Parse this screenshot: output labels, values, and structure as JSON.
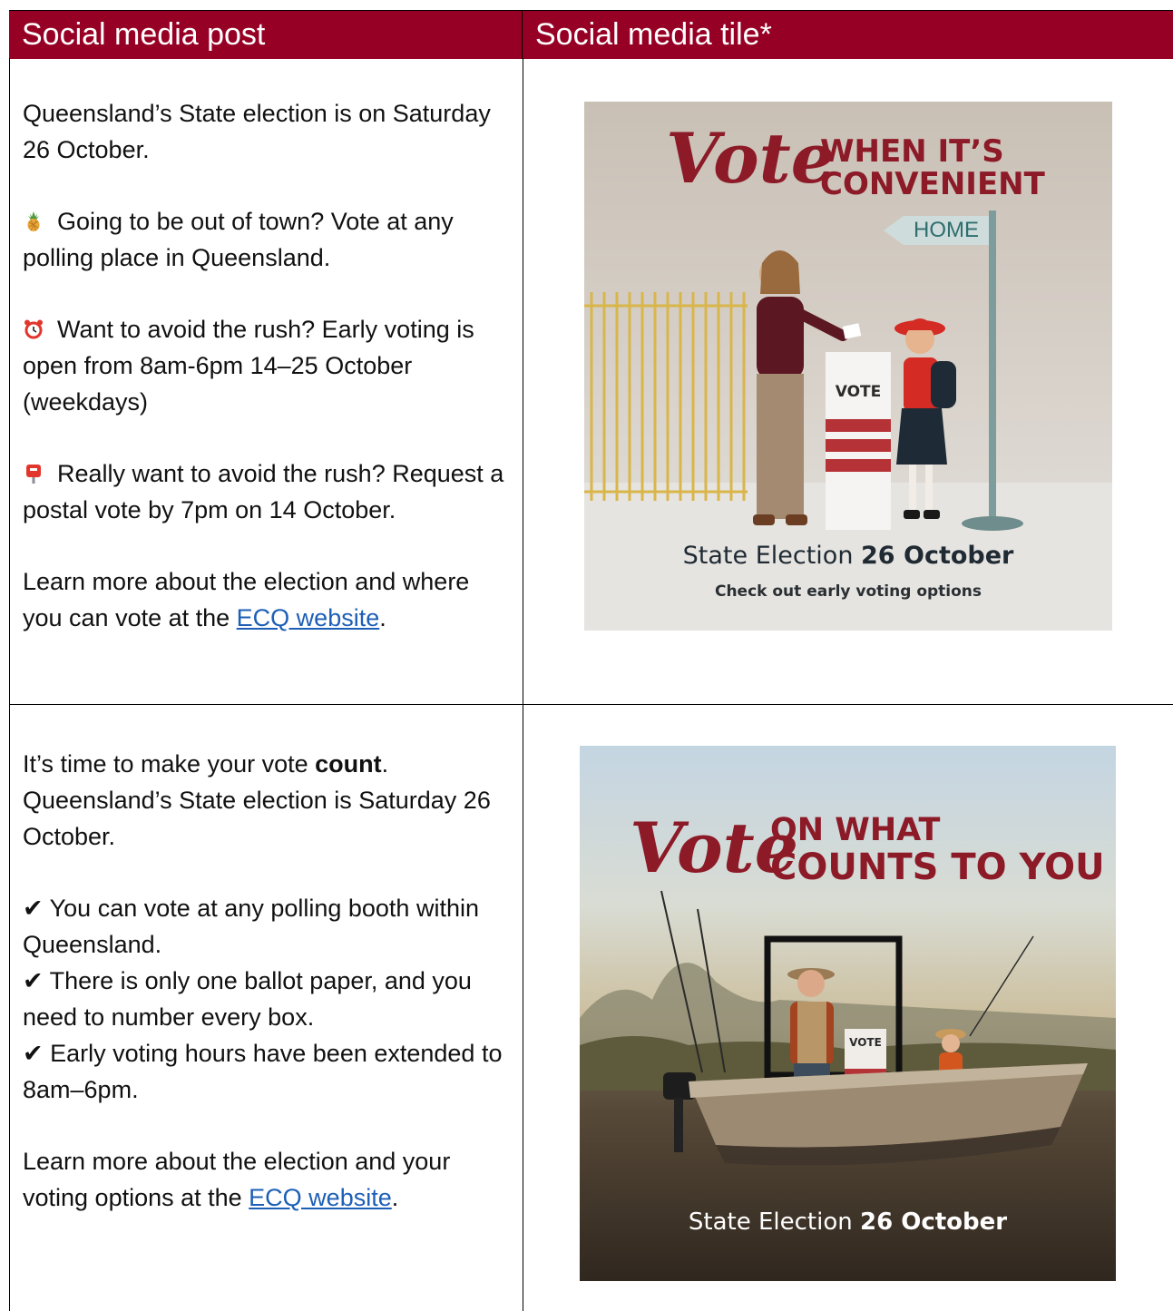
{
  "header": {
    "col1": "Social media post",
    "col2": "Social media tile*"
  },
  "post1": {
    "p1": "Queensland’s State election is on Saturday 26 October.",
    "p2": "Going to be out of town? Vote at any polling place in Queensland.",
    "p3": "Want to avoid the rush? Early voting is open from 8am-6pm 14–25 October (weekdays)",
    "p4": "Really want to avoid the rush? Request a postal vote by 7pm on 14 October.",
    "p5_before": "Learn more about the election and where you can vote at the ",
    "p5_link": "ECQ website",
    "p5_after": "."
  },
  "post2": {
    "p1_before": "It’s time to make your vote ",
    "p1_bold": "count",
    "p1_after": ". Queensland’s State election is Saturday 26 October.",
    "check1": "✔ You can vote at any polling booth within Queensland.",
    "check2": "✔ There is only one ballot paper, and you need to number every box.",
    "check3": "✔ Early voting hours have been extended to 8am–6pm.",
    "p3_before": "Learn more about the election and your voting options at the ",
    "p3_link": "ECQ website",
    "p3_after": "."
  },
  "tile1": {
    "script": "Vote",
    "heading_line1": "WHEN IT’S",
    "heading_line2": "CONVENIENT",
    "sign": "HOME",
    "box_label": "VOTE",
    "big_text_normal": "State Election ",
    "big_text_bold": "26 October",
    "small_text": "Check out early voting options"
  },
  "tile2": {
    "script": "Vote",
    "heading_line1": "ON WHAT",
    "heading_line2": "COUNTS TO YOU",
    "box_label": "VOTE",
    "big_text_normal": "State Election ",
    "big_text_bold": "26 October"
  },
  "colors": {
    "header_bg": "#970025",
    "brand_red": "#8c1a27",
    "link": "#1d5fb6"
  }
}
